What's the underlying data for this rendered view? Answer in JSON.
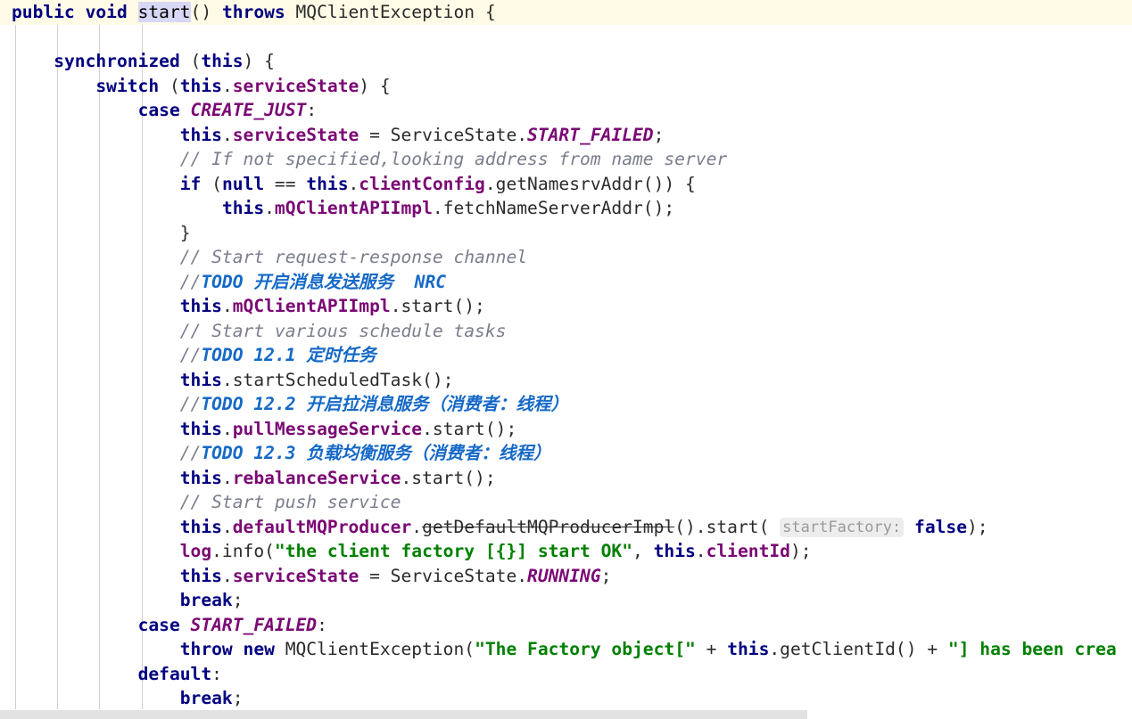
{
  "editor": {
    "language": "Java",
    "theme": "IntelliJ Light",
    "current_line_index": 0,
    "caret_token": "start",
    "inline_hint": "startFactory:",
    "colors": {
      "background": "#ffffff",
      "current_line_highlight": "#fffbe6",
      "selection": "#d8d8f6",
      "indent_guide": "#d0d0d0",
      "keyword": "#000080",
      "field": "#7a0874",
      "enum_constant": "#7a0874",
      "string": "#008000",
      "comment": "#7a7e8c",
      "todo_comment": "#1569c7",
      "plain_text": "#2b2b2b",
      "inline_hint_bg": "#ededed",
      "inline_hint_fg": "#999999",
      "scrollbar_thumb": "#e2e2e2"
    },
    "indent_guide_x": [
      17,
      64,
      111,
      159
    ],
    "scrollbar": {
      "orientation": "horizontal",
      "thumb_left": 0,
      "thumb_width": 905
    }
  },
  "code": {
    "lines": [
      {
        "id": "line-1",
        "current": true,
        "tokens": [
          {
            "t": "public",
            "c": "kw"
          },
          {
            "t": " ",
            "c": "plain"
          },
          {
            "t": "void",
            "c": "kw"
          },
          {
            "t": " ",
            "c": "plain"
          },
          {
            "t": "start",
            "c": "sel",
            "caret_before": true
          },
          {
            "t": "() ",
            "c": "plain"
          },
          {
            "t": "throws",
            "c": "kw"
          },
          {
            "t": " MQClientException {",
            "c": "plain"
          }
        ]
      },
      {
        "id": "line-2",
        "tokens": []
      },
      {
        "id": "line-3",
        "tokens": [
          {
            "t": "    ",
            "c": "plain"
          },
          {
            "t": "synchronized",
            "c": "kw"
          },
          {
            "t": " (",
            "c": "plain"
          },
          {
            "t": "this",
            "c": "kw"
          },
          {
            "t": ") {",
            "c": "plain"
          }
        ]
      },
      {
        "id": "line-4",
        "tokens": [
          {
            "t": "        ",
            "c": "plain"
          },
          {
            "t": "switch",
            "c": "kw"
          },
          {
            "t": " (",
            "c": "plain"
          },
          {
            "t": "this",
            "c": "kw"
          },
          {
            "t": ".",
            "c": "plain"
          },
          {
            "t": "serviceState",
            "c": "field"
          },
          {
            "t": ") {",
            "c": "plain"
          }
        ]
      },
      {
        "id": "line-5",
        "tokens": [
          {
            "t": "            ",
            "c": "plain"
          },
          {
            "t": "case",
            "c": "kw"
          },
          {
            "t": " ",
            "c": "plain"
          },
          {
            "t": "CREATE_JUST",
            "c": "enumc"
          },
          {
            "t": ":",
            "c": "plain"
          }
        ]
      },
      {
        "id": "line-6",
        "tokens": [
          {
            "t": "                ",
            "c": "plain"
          },
          {
            "t": "this",
            "c": "kw"
          },
          {
            "t": ".",
            "c": "plain"
          },
          {
            "t": "serviceState",
            "c": "field"
          },
          {
            "t": " = ServiceState.",
            "c": "plain"
          },
          {
            "t": "START_FAILED",
            "c": "enumc"
          },
          {
            "t": ";",
            "c": "plain"
          }
        ]
      },
      {
        "id": "line-7",
        "tokens": [
          {
            "t": "                ",
            "c": "plain"
          },
          {
            "t": "// If not specified,looking address from name server",
            "c": "cmt"
          }
        ]
      },
      {
        "id": "line-8",
        "tokens": [
          {
            "t": "                ",
            "c": "plain"
          },
          {
            "t": "if",
            "c": "kw"
          },
          {
            "t": " (",
            "c": "plain"
          },
          {
            "t": "null",
            "c": "kw"
          },
          {
            "t": " == ",
            "c": "plain"
          },
          {
            "t": "this",
            "c": "kw"
          },
          {
            "t": ".",
            "c": "plain"
          },
          {
            "t": "clientConfig",
            "c": "field"
          },
          {
            "t": ".getNamesrvAddr()) {",
            "c": "plain"
          }
        ]
      },
      {
        "id": "line-9",
        "tokens": [
          {
            "t": "                    ",
            "c": "plain"
          },
          {
            "t": "this",
            "c": "kw"
          },
          {
            "t": ".",
            "c": "plain"
          },
          {
            "t": "mQClientAPIImpl",
            "c": "field"
          },
          {
            "t": ".fetchNameServerAddr();",
            "c": "plain"
          }
        ]
      },
      {
        "id": "line-10",
        "tokens": [
          {
            "t": "                }",
            "c": "plain"
          }
        ]
      },
      {
        "id": "line-11",
        "tokens": [
          {
            "t": "                ",
            "c": "plain"
          },
          {
            "t": "// Start request-response channel",
            "c": "cmt"
          }
        ]
      },
      {
        "id": "line-12",
        "tokens": [
          {
            "t": "                ",
            "c": "plain"
          },
          {
            "t": "//",
            "c": "cmt"
          },
          {
            "t": "TODO 开启消息发送服务  NRC",
            "c": "todo"
          }
        ]
      },
      {
        "id": "line-13",
        "tokens": [
          {
            "t": "                ",
            "c": "plain"
          },
          {
            "t": "this",
            "c": "kw"
          },
          {
            "t": ".",
            "c": "plain"
          },
          {
            "t": "mQClientAPIImpl",
            "c": "field"
          },
          {
            "t": ".start();",
            "c": "plain"
          }
        ]
      },
      {
        "id": "line-14",
        "tokens": [
          {
            "t": "                ",
            "c": "plain"
          },
          {
            "t": "// Start various schedule tasks",
            "c": "cmt"
          }
        ]
      },
      {
        "id": "line-15",
        "tokens": [
          {
            "t": "                ",
            "c": "plain"
          },
          {
            "t": "//",
            "c": "cmt"
          },
          {
            "t": "TODO 12.1 定时任务",
            "c": "todo"
          }
        ]
      },
      {
        "id": "line-16",
        "tokens": [
          {
            "t": "                ",
            "c": "plain"
          },
          {
            "t": "this",
            "c": "kw"
          },
          {
            "t": ".startScheduledTask();",
            "c": "plain"
          }
        ]
      },
      {
        "id": "line-17",
        "tokens": [
          {
            "t": "                ",
            "c": "plain"
          },
          {
            "t": "//",
            "c": "cmt"
          },
          {
            "t": "TODO 12.2 开启拉消息服务（消费者：线程）",
            "c": "todo"
          }
        ]
      },
      {
        "id": "line-18",
        "tokens": [
          {
            "t": "                ",
            "c": "plain"
          },
          {
            "t": "this",
            "c": "kw"
          },
          {
            "t": ".",
            "c": "plain"
          },
          {
            "t": "pullMessageService",
            "c": "field"
          },
          {
            "t": ".start();",
            "c": "plain"
          }
        ]
      },
      {
        "id": "line-19",
        "tokens": [
          {
            "t": "                ",
            "c": "plain"
          },
          {
            "t": "//",
            "c": "cmt"
          },
          {
            "t": "TODO 12.3 负载均衡服务（消费者：线程）",
            "c": "todo"
          }
        ]
      },
      {
        "id": "line-20",
        "tokens": [
          {
            "t": "                ",
            "c": "plain"
          },
          {
            "t": "this",
            "c": "kw"
          },
          {
            "t": ".",
            "c": "plain"
          },
          {
            "t": "rebalanceService",
            "c": "field"
          },
          {
            "t": ".start();",
            "c": "plain"
          }
        ]
      },
      {
        "id": "line-21",
        "tokens": [
          {
            "t": "                ",
            "c": "plain"
          },
          {
            "t": "// Start push service",
            "c": "cmt"
          }
        ]
      },
      {
        "id": "line-22",
        "tokens": [
          {
            "t": "                ",
            "c": "plain"
          },
          {
            "t": "this",
            "c": "kw"
          },
          {
            "t": ".",
            "c": "plain"
          },
          {
            "t": "defaultMQProducer",
            "c": "field"
          },
          {
            "t": ".",
            "c": "plain"
          },
          {
            "t": "getDefaultMQProducerImpl",
            "c": "depr"
          },
          {
            "t": "().start( ",
            "c": "plain"
          },
          {
            "t": "startFactory:",
            "c": "hint"
          },
          {
            "t": " ",
            "c": "plain"
          },
          {
            "t": "false",
            "c": "kw"
          },
          {
            "t": ");",
            "c": "plain"
          }
        ]
      },
      {
        "id": "line-23",
        "tokens": [
          {
            "t": "                ",
            "c": "plain"
          },
          {
            "t": "log",
            "c": "field"
          },
          {
            "t": ".info(",
            "c": "plain"
          },
          {
            "t": "\"the client factory [{}] start OK\"",
            "c": "str"
          },
          {
            "t": ", ",
            "c": "plain"
          },
          {
            "t": "this",
            "c": "kw"
          },
          {
            "t": ".",
            "c": "plain"
          },
          {
            "t": "clientId",
            "c": "field"
          },
          {
            "t": ");",
            "c": "plain"
          }
        ]
      },
      {
        "id": "line-24",
        "tokens": [
          {
            "t": "                ",
            "c": "plain"
          },
          {
            "t": "this",
            "c": "kw"
          },
          {
            "t": ".",
            "c": "plain"
          },
          {
            "t": "serviceState",
            "c": "field"
          },
          {
            "t": " = ServiceState.",
            "c": "plain"
          },
          {
            "t": "RUNNING",
            "c": "enumc"
          },
          {
            "t": ";",
            "c": "plain"
          }
        ]
      },
      {
        "id": "line-25",
        "tokens": [
          {
            "t": "                ",
            "c": "plain"
          },
          {
            "t": "break",
            "c": "kw"
          },
          {
            "t": ";",
            "c": "plain"
          }
        ]
      },
      {
        "id": "line-26",
        "tokens": [
          {
            "t": "            ",
            "c": "plain"
          },
          {
            "t": "case",
            "c": "kw"
          },
          {
            "t": " ",
            "c": "plain"
          },
          {
            "t": "START_FAILED",
            "c": "enumc"
          },
          {
            "t": ":",
            "c": "plain"
          }
        ]
      },
      {
        "id": "line-27",
        "tokens": [
          {
            "t": "                ",
            "c": "plain"
          },
          {
            "t": "throw",
            "c": "kw"
          },
          {
            "t": " ",
            "c": "plain"
          },
          {
            "t": "new",
            "c": "kw"
          },
          {
            "t": " MQClientException(",
            "c": "plain"
          },
          {
            "t": "\"The Factory object[\"",
            "c": "str"
          },
          {
            "t": " + ",
            "c": "plain"
          },
          {
            "t": "this",
            "c": "kw"
          },
          {
            "t": ".getClientId() + ",
            "c": "plain"
          },
          {
            "t": "\"] has been crea",
            "c": "str"
          }
        ]
      },
      {
        "id": "line-28",
        "tokens": [
          {
            "t": "            ",
            "c": "plain"
          },
          {
            "t": "default",
            "c": "kw"
          },
          {
            "t": ":",
            "c": "plain"
          }
        ]
      },
      {
        "id": "line-29",
        "tokens": [
          {
            "t": "                ",
            "c": "plain"
          },
          {
            "t": "break",
            "c": "kw"
          },
          {
            "t": ";",
            "c": "plain"
          }
        ]
      }
    ]
  }
}
